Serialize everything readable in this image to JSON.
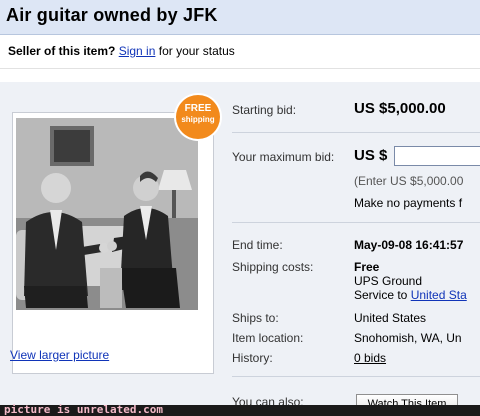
{
  "header": {
    "title": "Air guitar owned by JFK"
  },
  "seller": {
    "prefix": "Seller of this item?",
    "sign_in": "Sign in",
    "suffix": "for your status"
  },
  "badge": {
    "line1": "FREE",
    "line2": "shipping"
  },
  "photo": {
    "view_larger": "View larger picture"
  },
  "bid": {
    "starting_label": "Starting bid:",
    "starting_value": "US $5,000.00",
    "max_label": "Your maximum bid:",
    "max_currency": "US $",
    "enter_hint": "(Enter US $5,000.00",
    "payments_note": "Make no payments f"
  },
  "details": {
    "end_label": "End time:",
    "end_value": "May-09-08 16:41:57",
    "shipping_label": "Shipping costs:",
    "shipping_value": "Free",
    "shipping_service": "UPS Ground",
    "shipping_to_prefix": "Service to",
    "shipping_to_link": "United Sta",
    "ships_label": "Ships to:",
    "ships_value": "United States",
    "location_label": "Item location:",
    "location_value": "Snohomish, WA, Un",
    "history_label": "History:",
    "history_value": "0 bids"
  },
  "actions": {
    "you_can_label": "You can also:",
    "watch_button": "Watch This Item"
  },
  "watermark": {
    "text": "picture is unrelated.com"
  },
  "colors": {
    "title_bar": "#dde6f5",
    "panel": "#eef1f6",
    "link": "#1034b8",
    "badge": "#f28a1c"
  }
}
